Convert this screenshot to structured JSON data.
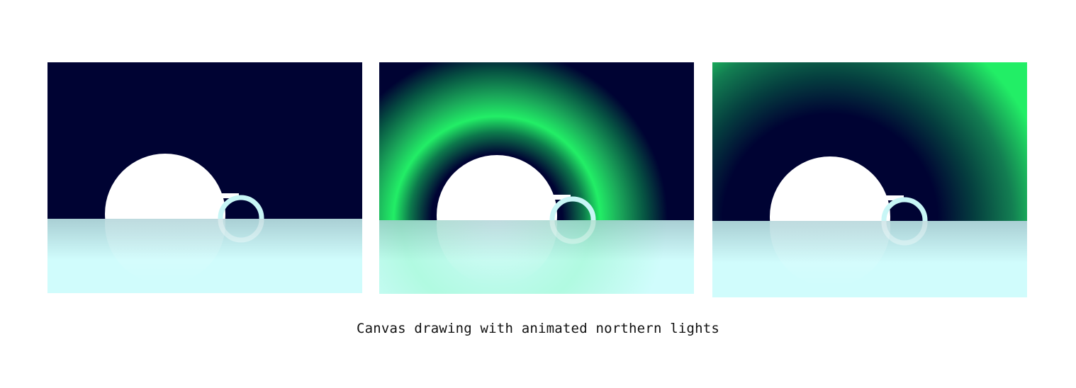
{
  "caption": "Canvas drawing with animated northern lights",
  "colors": {
    "night_sky": "#000333",
    "aurora": "#22ee66",
    "ice": "#d0fcfc",
    "moon": "#ffffff",
    "ring": "#c8f6f6"
  },
  "frames": [
    {
      "name": "frame-1",
      "aurora": "none"
    },
    {
      "name": "frame-2",
      "aurora": "arc"
    },
    {
      "name": "frame-3",
      "aurora": "corner-top-right"
    }
  ]
}
